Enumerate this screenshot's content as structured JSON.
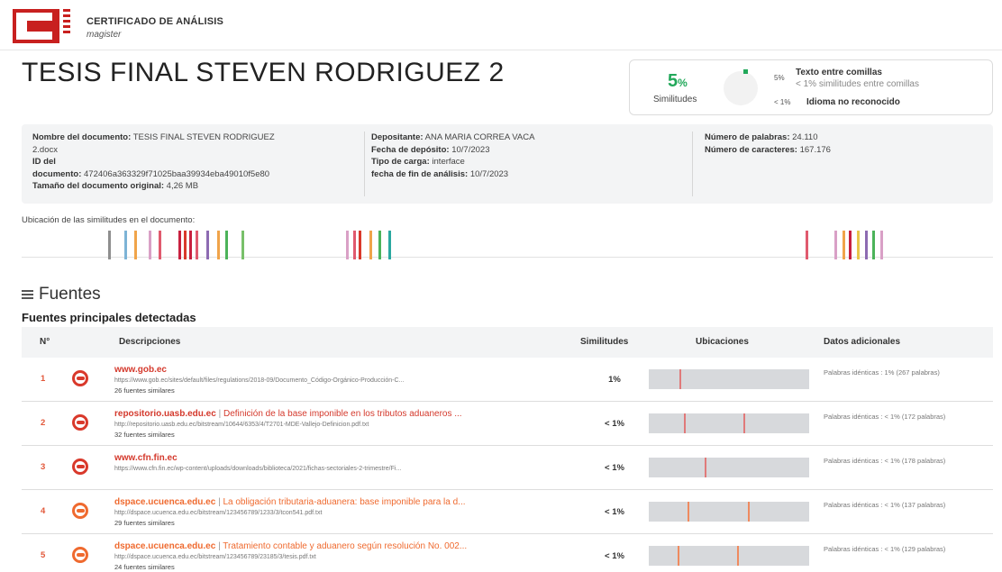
{
  "header": {
    "cert_title": "CERTIFICADO DE ANÁLISIS",
    "cert_sub": "magister",
    "doc_title": "TESIS FINAL STEVEN RODRIGUEZ 2"
  },
  "summary": {
    "pct_value": "5",
    "pct_unit": "%",
    "pct_label": "Similitudes",
    "legend": [
      {
        "pct": "5%",
        "label": "Texto entre comillas",
        "light": false
      },
      {
        "pct": "",
        "label": "< 1% similitudes entre comillas",
        "light": true
      },
      {
        "pct": "< 1%",
        "label": "Idioma no reconocido",
        "light": false
      }
    ]
  },
  "info": {
    "name_label": "Nombre del documento:",
    "name_value": "TESIS FINAL STEVEN RODRIGUEZ",
    "name_value2": "2.docx",
    "id_label": "ID del",
    "id_label2": "documento:",
    "id_value": "472406a363329f71025baa39934eba49010f5e80",
    "size_label": "Tamaño del documento original:",
    "size_value": "4,26 MB",
    "dep_label": "Depositante:",
    "dep_value": "ANA MARIA CORREA VACA",
    "fdep_label": "Fecha de depósito:",
    "fdep_value": "10/7/2023",
    "tipo_label": "Tipo de carga:",
    "tipo_value": "interface",
    "ffin_label": "fecha de fin de análisis:",
    "ffin_value": "10/7/2023",
    "words_label": "Número de palabras:",
    "words_value": "24.110",
    "chars_label": "Número de caracteres:",
    "chars_value": "167.176"
  },
  "location_label": "Ubicación de las similitudes en el documento:",
  "location_marks": [
    {
      "pos": 0.089,
      "color": "#8e8e8e"
    },
    {
      "pos": 0.106,
      "color": "#7db3d6"
    },
    {
      "pos": 0.116,
      "color": "#f0a44a"
    },
    {
      "pos": 0.131,
      "color": "#d9a0c6"
    },
    {
      "pos": 0.141,
      "color": "#e05a6e"
    },
    {
      "pos": 0.161,
      "color": "#c8203f"
    },
    {
      "pos": 0.167,
      "color": "#d9392b"
    },
    {
      "pos": 0.173,
      "color": "#c8203f"
    },
    {
      "pos": 0.179,
      "color": "#e05a6e"
    },
    {
      "pos": 0.19,
      "color": "#8d6bb2"
    },
    {
      "pos": 0.201,
      "color": "#f0a44a"
    },
    {
      "pos": 0.21,
      "color": "#4cb35a"
    },
    {
      "pos": 0.226,
      "color": "#78c06a"
    },
    {
      "pos": 0.334,
      "color": "#d9a0c6"
    },
    {
      "pos": 0.341,
      "color": "#e05a6e"
    },
    {
      "pos": 0.347,
      "color": "#d9392b"
    },
    {
      "pos": 0.358,
      "color": "#f0a44a"
    },
    {
      "pos": 0.367,
      "color": "#4cb35a"
    },
    {
      "pos": 0.378,
      "color": "#2aa8a0"
    },
    {
      "pos": 0.807,
      "color": "#e05a6e"
    },
    {
      "pos": 0.837,
      "color": "#d9a0c6"
    },
    {
      "pos": 0.845,
      "color": "#f0a44a"
    },
    {
      "pos": 0.852,
      "color": "#c8203f"
    },
    {
      "pos": 0.86,
      "color": "#e8c64a"
    },
    {
      "pos": 0.868,
      "color": "#8d6bb2"
    },
    {
      "pos": 0.876,
      "color": "#4cb35a"
    },
    {
      "pos": 0.884,
      "color": "#d9a0c6"
    }
  ],
  "fuentes_title": "Fuentes",
  "fuentes_sub": "Fuentes principales detectadas",
  "table": {
    "headers": {
      "num": "N°",
      "desc": "Descripciones",
      "sim": "Similitudes",
      "loc": "Ubicaciones",
      "extra": "Datos adicionales"
    },
    "rows": [
      {
        "num": "1",
        "icon": "globe-icon",
        "domain": "www.gob.ec",
        "title": "",
        "url": "https://www.gob.ec/sites/default/files/regulations/2018-09/Documento_Código-Orgánico-Producción-C...",
        "count": "26 fuentes similares",
        "sim": "1%",
        "marks": [
          0.19
        ],
        "extra": "Palabras idénticas : 1% (267 palabras)"
      },
      {
        "num": "2",
        "icon": "globe-icon",
        "domain": "repositorio.uasb.edu.ec",
        "title": "Definición de la base imponible en los tributos aduaneros ...",
        "url": "http://repositorio.uasb.edu.ec/bitstream/10644/6353/4/T2701-MDE-Vallejo-Definicion.pdf.txt",
        "count": "32 fuentes similares",
        "sim": "< 1%",
        "marks": [
          0.22,
          0.59
        ],
        "extra": "Palabras idénticas : < 1% (172 palabras)"
      },
      {
        "num": "3",
        "icon": "globe-icon",
        "domain": "www.cfn.fin.ec",
        "title": "",
        "url": "https://www.cfn.fin.ec/wp-content/uploads/downloads/biblioteca/2021/fichas-sectoriales-2-trimestre/Fi...",
        "count": "",
        "sim": "< 1%",
        "marks": [
          0.35
        ],
        "extra": "Palabras idénticas : < 1% (178 palabras)"
      },
      {
        "num": "4",
        "icon": "globe-icon",
        "domain": "dspace.ucuenca.edu.ec",
        "title": "La obligación tributaria-aduanera: base imponible para la d...",
        "url": "http://dspace.ucuenca.edu.ec/bitstream/123456789/1233/3/tcon541.pdf.txt",
        "count": "29 fuentes similares",
        "sim": "< 1%",
        "marks": [
          0.24,
          0.62
        ],
        "extra": "Palabras idénticas : < 1% (137 palabras)"
      },
      {
        "num": "5",
        "icon": "globe-icon",
        "domain": "dspace.ucuenca.edu.ec",
        "title": "Tratamiento contable y aduanero según resolución No. 002...",
        "url": "http://dspace.ucuenca.edu.ec/bitstream/123456789/23185/3/tesis.pdf.txt",
        "count": "24 fuentes similares",
        "sim": "< 1%",
        "marks": [
          0.18,
          0.55
        ],
        "extra": "Palabras idénticas : < 1% (129 palabras)"
      }
    ]
  },
  "colors": {
    "accent": "#c8201f",
    "green": "#22a85a",
    "source_red": "#d4392c",
    "source_orange": "#ef6a2f"
  }
}
